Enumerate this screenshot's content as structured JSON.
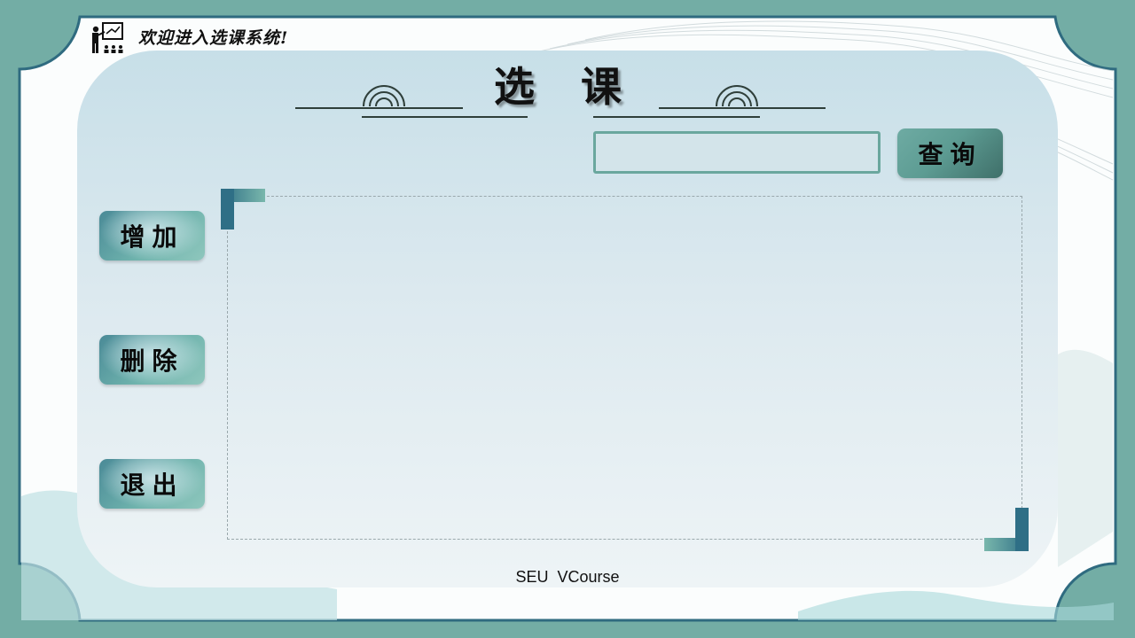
{
  "header": {
    "welcome_text": "欢迎进入选课系统!",
    "icon": "teacher-presentation-icon"
  },
  "title": {
    "char1": "选",
    "char2": "课"
  },
  "search": {
    "value": "",
    "placeholder": ""
  },
  "buttons": {
    "query_label": "查询",
    "add_label": "增加",
    "delete_label": "删除",
    "exit_label": "退出"
  },
  "footer": {
    "text": "SEU  VCourse"
  },
  "colors": {
    "frame": "#73ada5",
    "border": "#2f6b80",
    "panel_top": "#c7dfe8",
    "panel_bottom": "#eef4f6",
    "accent_teal": "#6aa79e"
  }
}
